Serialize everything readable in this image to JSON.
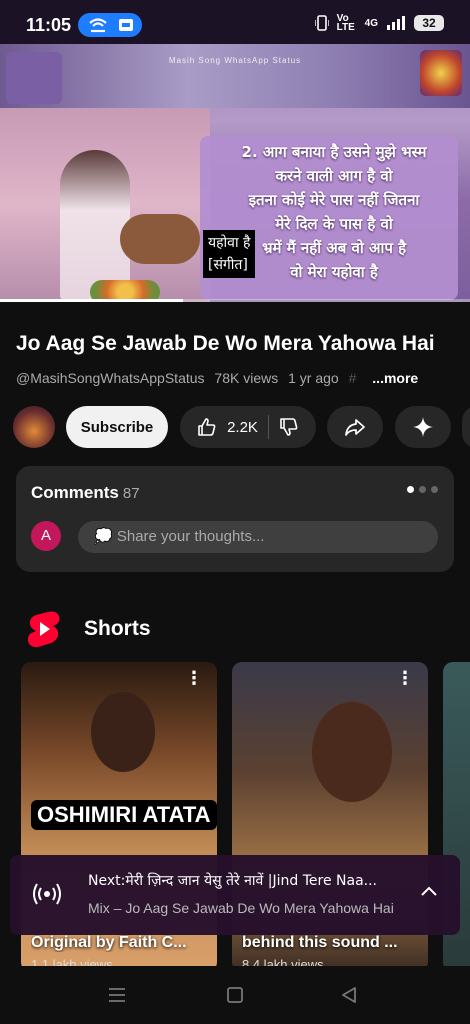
{
  "status": {
    "time": "11:05",
    "network": "Vo LTE",
    "signal": "4G",
    "battery": "32"
  },
  "video": {
    "watermark": "Masih Song WhatsApp Status",
    "lyrics": [
      "2. आग बनाया है उसने मुझे भस्म",
      "करने वाली आग है वो",
      "इतना कोई मेरे पास नहीं जितना",
      "मेरे दिल के पास है वो",
      "भ्रमें मैं नहीं अब वो आप है",
      "वो मेरा यहोवा है"
    ],
    "caption_line1": "यहोवा है",
    "caption_line2": "[संगीत]",
    "progress": 0.39
  },
  "title": "Jo Aag Se Jawab De Wo Mera Yahowa Hai",
  "meta": {
    "channel": "@MasihSongWhatsAppStatus",
    "views": "78K views",
    "age": "1 yr ago",
    "hash": "#",
    "more": "...more"
  },
  "actions": {
    "subscribe": "Subscribe",
    "likes": "2.2K"
  },
  "comments": {
    "label": "Comments",
    "count": "87",
    "avatar_letter": "A",
    "placeholder": "Share your thoughts..."
  },
  "shorts": {
    "title": "Shorts",
    "items": [
      {
        "overlay": "OSHIMIRI ATATA",
        "caption": "Original by Faith C...",
        "views": "1.1 lakh views"
      },
      {
        "caption": "behind this sound ...",
        "views": "8.4 lakh views"
      }
    ]
  },
  "miniplayer": {
    "next": "Next:मेरी ज़िन्द जान येसु तेरे नावें |Jind Tere Naa...",
    "mix": "Mix – Jo Aag Se Jawab De Wo Mera Yahowa Hai"
  },
  "colors": {
    "background": "#0f0f0f",
    "chip": "#272727",
    "shorts_red": "#ff0033",
    "accent_blue": "#1e7cff"
  }
}
